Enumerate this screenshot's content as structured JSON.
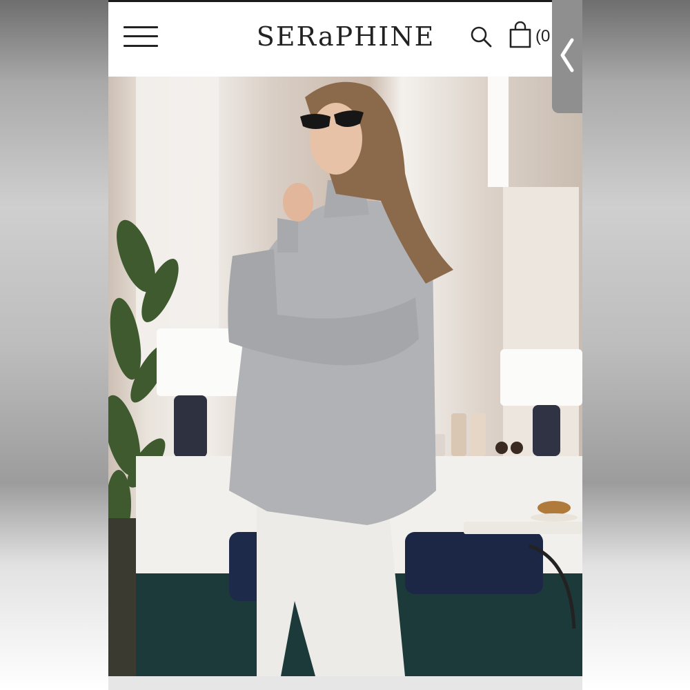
{
  "header": {
    "brand": "SERaPHINE",
    "cart_count_label": "(0"
  },
  "icons": {
    "menu": "hamburger-menu-icon",
    "search": "search-icon",
    "cart": "shopping-bag-icon",
    "collapse": "chevron-left-icon"
  },
  "carousel": {
    "total_slides": 8,
    "active_index": 1
  },
  "colors": {
    "header_bg": "#ffffff",
    "text": "#222222",
    "dot_inactive": "#8a8a8a",
    "dot_active": "#ffffff",
    "side_tab": "#8f8f8f"
  }
}
